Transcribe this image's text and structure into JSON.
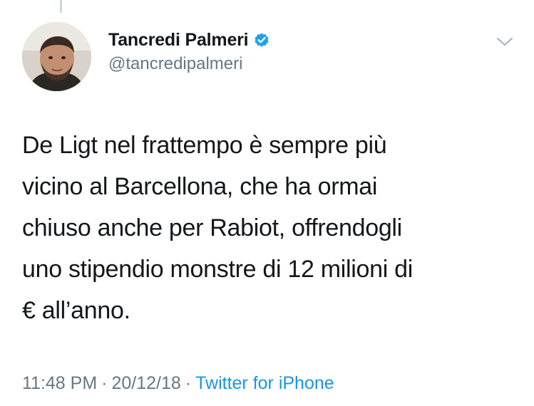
{
  "tweet": {
    "author": {
      "display_name": "Tancredi Palmeri",
      "handle": "@tancredipalmeri",
      "verified": true,
      "avatar_icon": "avatar-photo"
    },
    "text": "De Ligt nel frattempo è sempre più\nvicino al Barcellona, che ha ormai\nchiuso anche per Rabiot, offrendogli\nuno stipendio monstre di 12 milioni di\n€ all’anno.",
    "time": "11:48 PM",
    "date": "20/12/18",
    "separator": "·",
    "source": "Twitter for iPhone",
    "menu_icon": "chevron-down-icon"
  },
  "colors": {
    "text_primary": "#14171a",
    "text_secondary": "#657786",
    "link": "#1b95e0",
    "verified": "#1da1f2",
    "thread_line": "#ccd6dd"
  }
}
